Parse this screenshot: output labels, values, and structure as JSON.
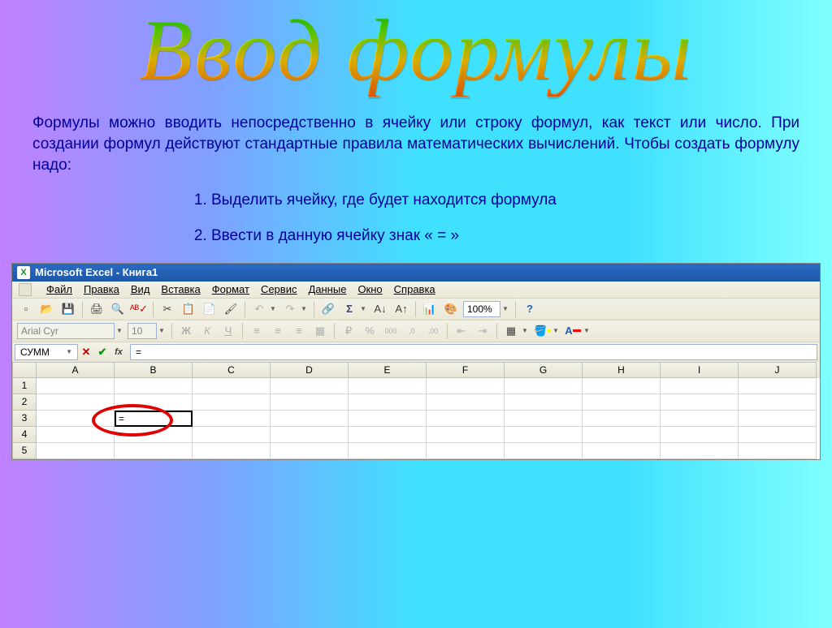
{
  "title": "Ввод формулы",
  "intro": "Формулы можно вводить непосредственно в ячейку или строку формул, как текст или число. При создании формул действуют стандартные правила математических вычислений. Чтобы создать формулу надо:",
  "steps": [
    "Выделить ячейку, где будет находится формула",
    "Ввести в данную ячейку знак « = »"
  ],
  "excel": {
    "titlebar": "Microsoft Excel - Книга1",
    "menu": [
      "Файл",
      "Правка",
      "Вид",
      "Вставка",
      "Формат",
      "Сервис",
      "Данные",
      "Окно",
      "Справка"
    ],
    "font_name": "Arial Cyr",
    "font_size": "10",
    "zoom": "100%",
    "name_box": "СУММ",
    "formula": "=",
    "columns": [
      "A",
      "B",
      "C",
      "D",
      "E",
      "F",
      "G",
      "H",
      "I",
      "J"
    ],
    "rows": [
      "1",
      "2",
      "3",
      "4",
      "5"
    ],
    "active_cell": {
      "row": 3,
      "col": "B",
      "value": "="
    },
    "icons": {
      "bold": "Ж",
      "italic": "К",
      "underline": "Ч",
      "sum": "Σ",
      "currency": "₽",
      "percent": "%",
      "thousands": "000",
      "dec_inc": ",0",
      "dec_dec": ",00"
    }
  }
}
